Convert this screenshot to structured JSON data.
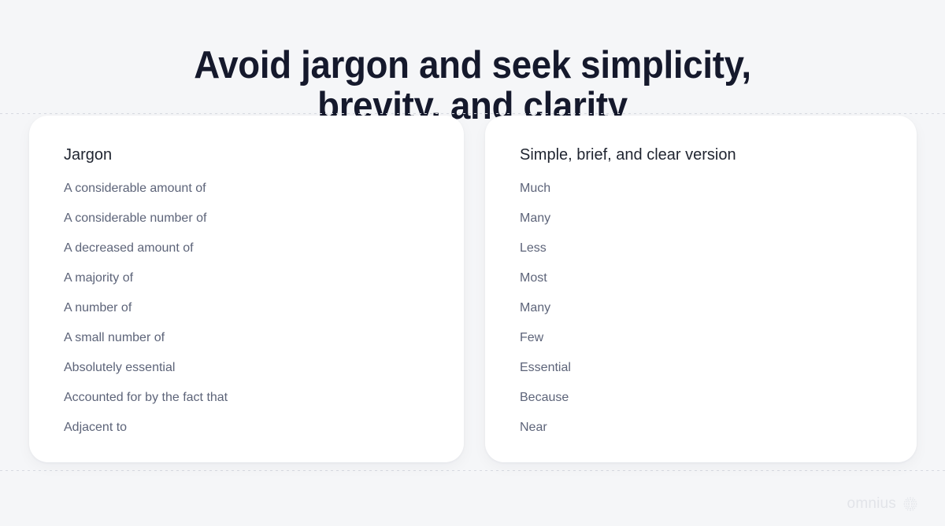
{
  "slide": {
    "title_line1": "Avoid jargon and seek simplicity,",
    "title_line2": "brevity, and clarity",
    "background_color": "#f5f6f8",
    "title_color": "#15192c",
    "guide_line_color": "#d7dae1"
  },
  "cards": {
    "left": {
      "heading": "Jargon",
      "heading_color": "#1f2430",
      "item_color": "#5d6479",
      "items": [
        "A considerable amount of",
        "A considerable number of",
        "A decreased amount of",
        "A majority of",
        "A number of",
        "A small number of",
        "Absolutely essential",
        "Accounted for by the fact that",
        "Adjacent to"
      ]
    },
    "right": {
      "heading": "Simple, brief, and clear version",
      "heading_color": "#1f2430",
      "item_color": "#5d6479",
      "items": [
        "Much",
        "Many",
        "Less",
        "Most",
        "Many",
        "Few",
        "Essential",
        "Because",
        "Near"
      ]
    }
  },
  "footer": {
    "logo_text": "omnius",
    "logo_icon": "dot-sphere-icon",
    "logo_color": "#e2e4e9"
  }
}
